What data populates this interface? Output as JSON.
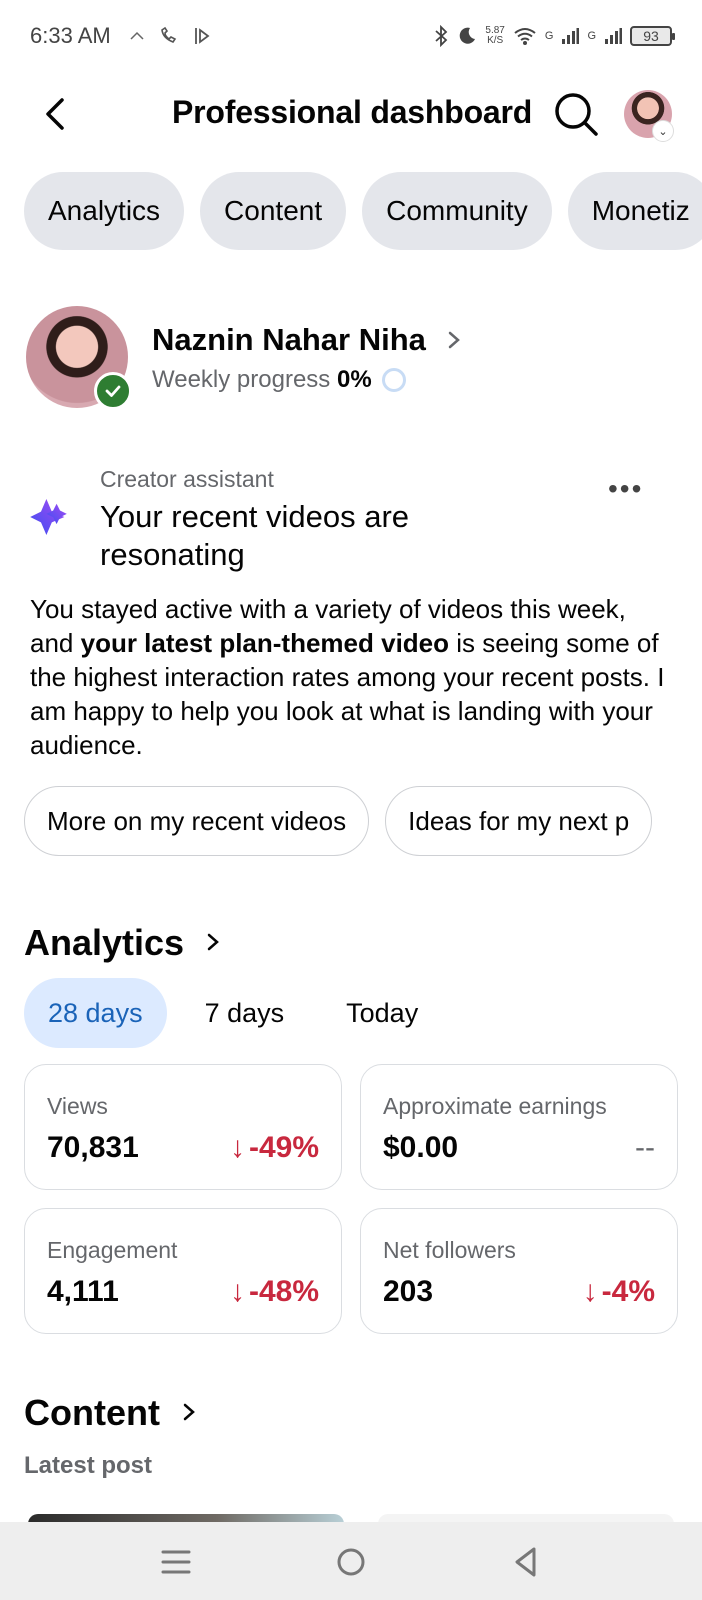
{
  "status_bar": {
    "time": "6:33 AM",
    "net_speed_value": "5.87",
    "net_speed_unit": "K/S",
    "signal_1": "G",
    "signal_2": "G",
    "battery": "93"
  },
  "header": {
    "title": "Professional dashboard",
    "back_icon": "arrow-left-icon",
    "search_icon": "search-icon"
  },
  "tabs": [
    {
      "label": "Analytics"
    },
    {
      "label": "Content"
    },
    {
      "label": "Community"
    },
    {
      "label": "Monetiz"
    }
  ],
  "profile": {
    "name": "Naznin Nahar Niha",
    "progress_label": "Weekly progress",
    "progress_value": "0%",
    "progress": 0
  },
  "assistant": {
    "label": "Creator assistant",
    "title": "Your recent videos are resonating",
    "body_part1": "You stayed active with a variety of videos this week, and ",
    "body_bold": "your latest plan-themed video",
    "body_part2": " is seeing some of the highest interaction rates among your recent posts. I am happy to help you look at what is landing with your audience.",
    "chips": [
      {
        "label": "More on my recent videos"
      },
      {
        "label": "Ideas for my next p"
      }
    ]
  },
  "analytics": {
    "title": "Analytics",
    "ranges": [
      {
        "label": "28 days",
        "active": true
      },
      {
        "label": "7 days",
        "active": false
      },
      {
        "label": "Today",
        "active": false
      }
    ],
    "cards": [
      {
        "label": "Views",
        "value": "70,831",
        "delta": "-49%",
        "arrow": "↓"
      },
      {
        "label": "Approximate earnings",
        "value": "$0.00",
        "delta": "--",
        "arrow": ""
      },
      {
        "label": "Engagement",
        "value": "4,111",
        "delta": "-48%",
        "arrow": "↓"
      },
      {
        "label": "Net followers",
        "value": "203",
        "delta": "-4%",
        "arrow": "↓"
      }
    ]
  },
  "content": {
    "title": "Content",
    "sub_label": "Latest post"
  },
  "colors": {
    "accent": "#1a63b8",
    "negative": "#c8283e",
    "verified": "#2e7d32",
    "chip_bg": "#e4e6eb"
  }
}
